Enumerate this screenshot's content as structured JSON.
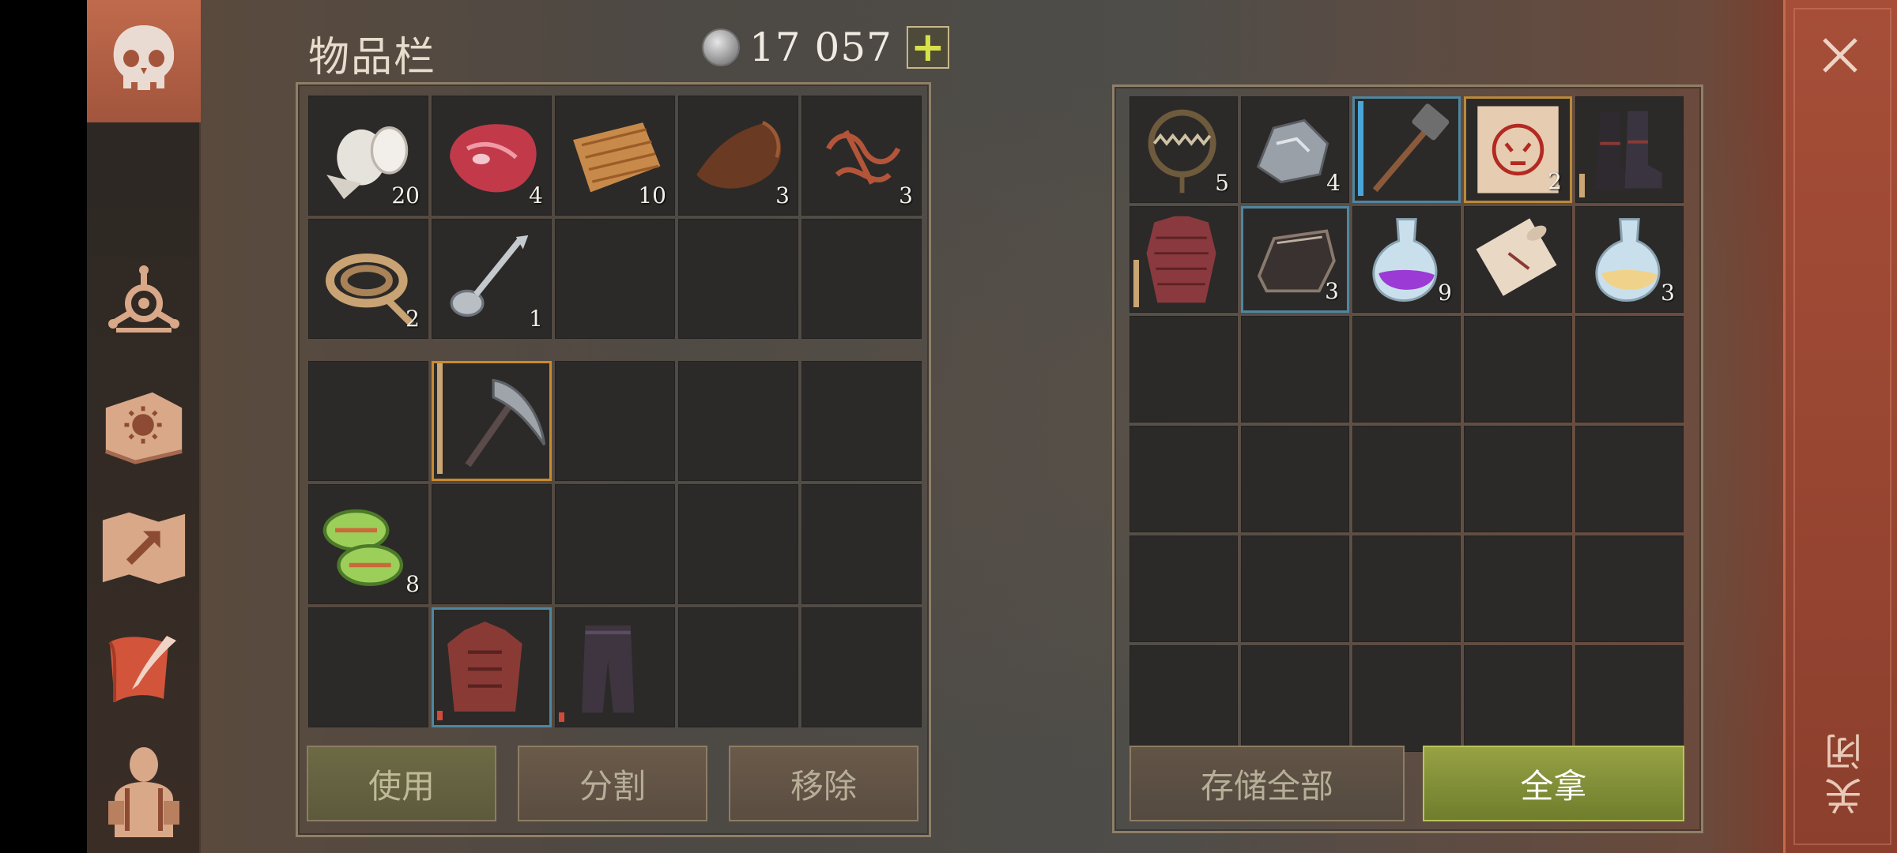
{
  "header": {
    "title": "物品栏",
    "currency_value": "17 057",
    "add_currency_label": "+"
  },
  "inventory": {
    "bag_items": [
      {
        "name": "cloth-roll-icon",
        "count": "20"
      },
      {
        "name": "raw-meat-icon",
        "count": "4"
      },
      {
        "name": "fiber-bundle-icon",
        "count": "10"
      },
      {
        "name": "leather-icon",
        "count": "3"
      },
      {
        "name": "copper-wire-icon",
        "count": "3"
      },
      {
        "name": "rope-icon",
        "count": "2"
      },
      {
        "name": "spoon-icon",
        "count": "1"
      },
      {
        "name": "",
        "count": ""
      },
      {
        "name": "",
        "count": ""
      },
      {
        "name": "",
        "count": ""
      }
    ],
    "equip_items": [
      {
        "name": "",
        "count": ""
      },
      {
        "name": "pickaxe-icon",
        "count": ""
      },
      {
        "name": "",
        "count": ""
      },
      {
        "name": "",
        "count": ""
      },
      {
        "name": "",
        "count": ""
      },
      {
        "name": "cactus-slices-icon",
        "count": "8"
      },
      {
        "name": "",
        "count": ""
      },
      {
        "name": "",
        "count": ""
      },
      {
        "name": "",
        "count": ""
      },
      {
        "name": "",
        "count": ""
      },
      {
        "name": "",
        "count": ""
      },
      {
        "name": "armor-vest-icon",
        "count": ""
      },
      {
        "name": "pants-icon",
        "count": ""
      },
      {
        "name": "",
        "count": ""
      },
      {
        "name": "",
        "count": ""
      }
    ],
    "buttons": {
      "use": "使用",
      "split": "分割",
      "remove": "移除"
    }
  },
  "storage": {
    "items": [
      {
        "name": "bear-trap-icon",
        "count": "5"
      },
      {
        "name": "iron-ore-icon",
        "count": "4"
      },
      {
        "name": "sledgehammer-icon",
        "count": ""
      },
      {
        "name": "bounty-poster-icon",
        "count": "2"
      },
      {
        "name": "boots-icon",
        "count": ""
      },
      {
        "name": "chainmail-icon",
        "count": ""
      },
      {
        "name": "iron-ingot-icon",
        "count": "3"
      },
      {
        "name": "purple-potion-icon",
        "count": "9"
      },
      {
        "name": "scroll-icon",
        "count": ""
      },
      {
        "name": "blue-potion-icon",
        "count": "3"
      }
    ],
    "buttons": {
      "store_all": "存储全部",
      "take_all": "全拿"
    }
  },
  "close": {
    "label": "关闭"
  },
  "colors": {
    "accent_green": "#97a244",
    "sidebar": "#b8644a",
    "right_rail": "#a64e38"
  }
}
